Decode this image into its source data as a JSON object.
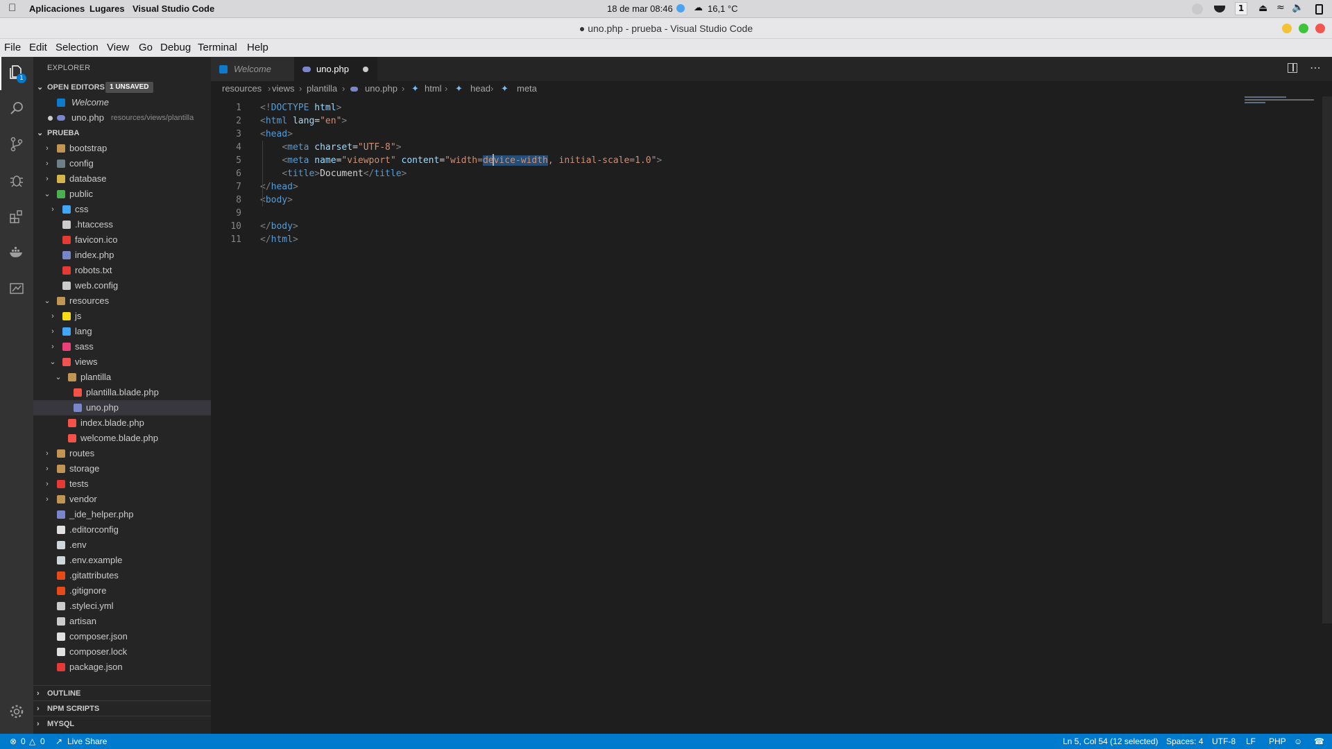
{
  "system_bar": {
    "applications": "Aplicaciones",
    "places": "Lugares",
    "active_app": "Visual Studio Code",
    "datetime": "18 de mar  08:46",
    "temperature": "16,1 °C",
    "workspace": "1"
  },
  "window": {
    "title": "uno.php - prueba - Visual Studio Code"
  },
  "menu": [
    "File",
    "Edit",
    "Selection",
    "View",
    "Go",
    "Debug",
    "Terminal",
    "Help"
  ],
  "activity_badge": "1",
  "explorer": {
    "title": "EXPLORER",
    "open_editors_label": "OPEN EDITORS",
    "unsaved_badge": "1 UNSAVED",
    "open_editors": [
      {
        "name": "Welcome",
        "path": ""
      },
      {
        "name": "uno.php",
        "path": "resources/views/plantilla"
      }
    ],
    "project_label": "PRUEBA",
    "tree": [
      {
        "name": "bootstrap",
        "indent": 0,
        "type": "folder",
        "expanded": false,
        "color": "#c09553"
      },
      {
        "name": "config",
        "indent": 0,
        "type": "folder",
        "expanded": false,
        "color": "#6d8086"
      },
      {
        "name": "database",
        "indent": 0,
        "type": "folder",
        "expanded": false,
        "color": "#d4b44c"
      },
      {
        "name": "public",
        "indent": 0,
        "type": "folder",
        "expanded": true,
        "color": "#4caf50"
      },
      {
        "name": "css",
        "indent": 1,
        "type": "folder",
        "expanded": false,
        "color": "#42a5f5"
      },
      {
        "name": ".htaccess",
        "indent": 1,
        "type": "file",
        "color": "#cccccc"
      },
      {
        "name": "favicon.ico",
        "indent": 1,
        "type": "file",
        "color": "#e53935"
      },
      {
        "name": "index.php",
        "indent": 1,
        "type": "file",
        "color": "#7986cb"
      },
      {
        "name": "robots.txt",
        "indent": 1,
        "type": "file",
        "color": "#e53935"
      },
      {
        "name": "web.config",
        "indent": 1,
        "type": "file",
        "color": "#cccccc"
      },
      {
        "name": "resources",
        "indent": 0,
        "type": "folder",
        "expanded": true,
        "color": "#c09553"
      },
      {
        "name": "js",
        "indent": 1,
        "type": "folder",
        "expanded": false,
        "color": "#f5de19"
      },
      {
        "name": "lang",
        "indent": 1,
        "type": "folder",
        "expanded": false,
        "color": "#42a5f5"
      },
      {
        "name": "sass",
        "indent": 1,
        "type": "folder",
        "expanded": false,
        "color": "#ec407a"
      },
      {
        "name": "views",
        "indent": 1,
        "type": "folder",
        "expanded": true,
        "color": "#ef5350"
      },
      {
        "name": "plantilla",
        "indent": 2,
        "type": "folder",
        "expanded": true,
        "color": "#c09553"
      },
      {
        "name": "plantilla.blade.php",
        "indent": 3,
        "type": "file",
        "color": "#f55247"
      },
      {
        "name": "uno.php",
        "indent": 3,
        "type": "file",
        "color": "#7986cb",
        "selected": true
      },
      {
        "name": "index.blade.php",
        "indent": 2,
        "type": "file",
        "color": "#f55247"
      },
      {
        "name": "welcome.blade.php",
        "indent": 2,
        "type": "file",
        "color": "#f55247"
      },
      {
        "name": "routes",
        "indent": 0,
        "type": "folder",
        "expanded": false,
        "color": "#c09553"
      },
      {
        "name": "storage",
        "indent": 0,
        "type": "folder",
        "expanded": false,
        "color": "#c09553"
      },
      {
        "name": "tests",
        "indent": 0,
        "type": "folder",
        "expanded": false,
        "color": "#e53935"
      },
      {
        "name": "vendor",
        "indent": 0,
        "type": "folder",
        "expanded": false,
        "color": "#c09553"
      },
      {
        "name": "_ide_helper.php",
        "indent": 0,
        "type": "file",
        "color": "#7986cb"
      },
      {
        "name": ".editorconfig",
        "indent": 0,
        "type": "file",
        "color": "#e0e0e0"
      },
      {
        "name": ".env",
        "indent": 0,
        "type": "file",
        "color": "#cfd8dc"
      },
      {
        "name": ".env.example",
        "indent": 0,
        "type": "file",
        "color": "#cfd8dc"
      },
      {
        "name": ".gitattributes",
        "indent": 0,
        "type": "file",
        "color": "#e64a19"
      },
      {
        "name": ".gitignore",
        "indent": 0,
        "type": "file",
        "color": "#e64a19"
      },
      {
        "name": ".styleci.yml",
        "indent": 0,
        "type": "file",
        "color": "#cccccc"
      },
      {
        "name": "artisan",
        "indent": 0,
        "type": "file",
        "color": "#cccccc"
      },
      {
        "name": "composer.json",
        "indent": 0,
        "type": "file",
        "color": "#e0e0e0"
      },
      {
        "name": "composer.lock",
        "indent": 0,
        "type": "file",
        "color": "#e0e0e0"
      },
      {
        "name": "package.json",
        "indent": 0,
        "type": "file",
        "color": "#e53935"
      }
    ],
    "outline_label": "OUTLINE",
    "npm_label": "NPM SCRIPTS",
    "mysql_label": "MYSQL"
  },
  "tabs": [
    {
      "label": "Welcome",
      "active": false
    },
    {
      "label": "uno.php",
      "active": true,
      "dirty": true
    }
  ],
  "breadcrumbs": [
    "resources",
    "views",
    "plantilla",
    "uno.php",
    "html",
    "head",
    "meta"
  ],
  "code_lines": [
    [
      [
        "t",
        "<!"
      ],
      [
        "tg",
        "DOCTYPE"
      ],
      [
        "tx",
        " "
      ],
      [
        "at",
        "html"
      ],
      [
        "t",
        ">"
      ]
    ],
    [
      [
        "t",
        "<"
      ],
      [
        "tg",
        "html"
      ],
      [
        "tx",
        " "
      ],
      [
        "at",
        "lang"
      ],
      [
        "tx",
        "="
      ],
      [
        "st",
        "\"en\""
      ],
      [
        "t",
        ">"
      ]
    ],
    [
      [
        "t",
        "<"
      ],
      [
        "tg",
        "head"
      ],
      [
        "t",
        ">"
      ]
    ],
    [
      [
        "tx",
        "    "
      ],
      [
        "t",
        "<"
      ],
      [
        "tg",
        "meta"
      ],
      [
        "tx",
        " "
      ],
      [
        "at",
        "charset"
      ],
      [
        "tx",
        "="
      ],
      [
        "st",
        "\"UTF-8\""
      ],
      [
        "t",
        ">"
      ]
    ],
    [
      [
        "tx",
        "    "
      ],
      [
        "t",
        "<"
      ],
      [
        "tg",
        "meta"
      ],
      [
        "tx",
        " "
      ],
      [
        "at",
        "name"
      ],
      [
        "tx",
        "="
      ],
      [
        "st",
        "\"viewport\""
      ],
      [
        "tx",
        " "
      ],
      [
        "at",
        "content"
      ],
      [
        "tx",
        "="
      ],
      [
        "st",
        "\"width="
      ],
      [
        "sel",
        "device-width"
      ],
      [
        "st",
        ", initial-scale=1.0\""
      ],
      [
        "t",
        ">"
      ]
    ],
    [
      [
        "tx",
        "    "
      ],
      [
        "t",
        "<"
      ],
      [
        "tg",
        "title"
      ],
      [
        "t",
        ">"
      ],
      [
        "tx",
        "Document"
      ],
      [
        "t",
        "</"
      ],
      [
        "tg",
        "title"
      ],
      [
        "t",
        ">"
      ]
    ],
    [
      [
        "t",
        "</"
      ],
      [
        "tg",
        "head"
      ],
      [
        "t",
        ">"
      ]
    ],
    [
      [
        "t",
        "<"
      ],
      [
        "tg",
        "body"
      ],
      [
        "t",
        ">"
      ]
    ],
    [
      [
        "tx",
        "    "
      ]
    ],
    [
      [
        "t",
        "</"
      ],
      [
        "tg",
        "body"
      ],
      [
        "t",
        ">"
      ]
    ],
    [
      [
        "t",
        "</"
      ],
      [
        "tg",
        "html"
      ],
      [
        "t",
        ">"
      ]
    ]
  ],
  "status": {
    "errors": "0",
    "warnings": "0",
    "live_share": "Live Share",
    "cursor": "Ln 5, Col 54 (12 selected)",
    "spaces": "Spaces: 4",
    "encoding": "UTF-8",
    "eol": "LF",
    "language": "PHP"
  }
}
